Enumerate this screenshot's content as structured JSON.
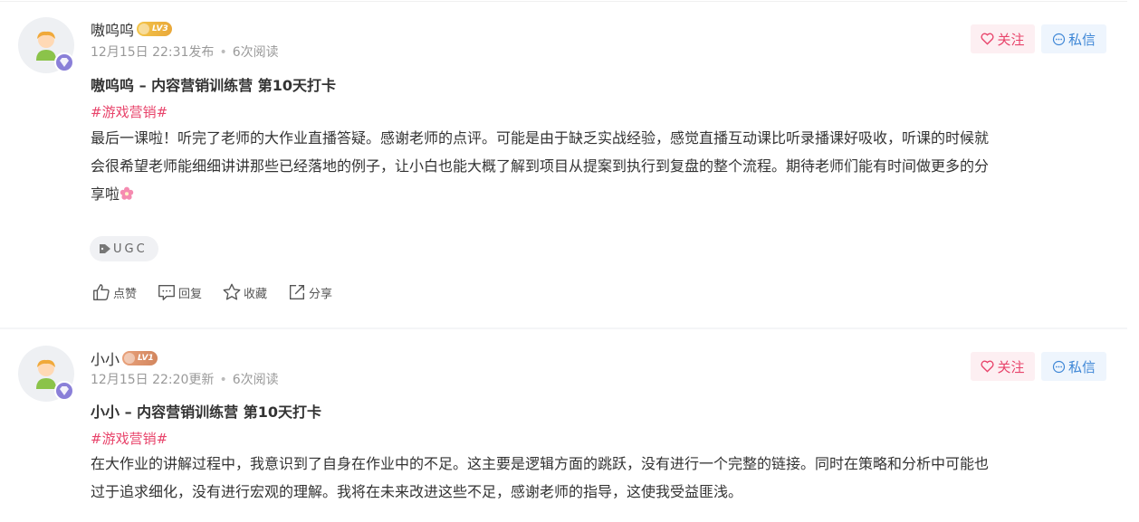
{
  "posts": [
    {
      "username": "嗷呜呜",
      "level": "LV3",
      "meta_time": "12月15日 22:31发布",
      "meta_reads": "6次阅读",
      "follow_label": "关注",
      "message_label": "私信",
      "title": "嗷呜呜 – 内容营销训练营 第10天打卡",
      "topic": "#游戏营销#",
      "content_line1": "最后一课啦！听完了老师的大作业直播答疑。感谢老师的点评。可能是由于缺乏实战经验，感觉直播互动课比听录播课好吸收，听课的时候就",
      "content_line2": "会很希望老师能细细讲讲那些已经落地的例子，让小白也能大概了解到项目从提案到执行到复盘的整个流程。期待老师们能有时间做更多的分",
      "content_line3": "享啦",
      "tag": "UGC",
      "actions": {
        "like": "点赞",
        "reply": "回复",
        "collect": "收藏",
        "share": "分享"
      }
    },
    {
      "username": "小小",
      "level": "LV1",
      "meta_time": "12月15日 22:20更新",
      "meta_reads": "6次阅读",
      "follow_label": "关注",
      "message_label": "私信",
      "title": "小小 – 内容营销训练营 第10天打卡",
      "topic": "#游戏营销#",
      "content_line1": "在大作业的讲解过程中，我意识到了自身在作业中的不足。这主要是逻辑方面的跳跃，没有进行一个完整的链接。同时在策略和分析中可能也",
      "content_line2": "过于追求细化，没有进行宏观的理解。我将在未来改进这些不足，感谢老师的指导，这使我受益匪浅。"
    }
  ],
  "colors": {
    "accent_pink": "#e8446b",
    "accent_blue": "#3d86d6",
    "meta_gray": "#999999"
  }
}
